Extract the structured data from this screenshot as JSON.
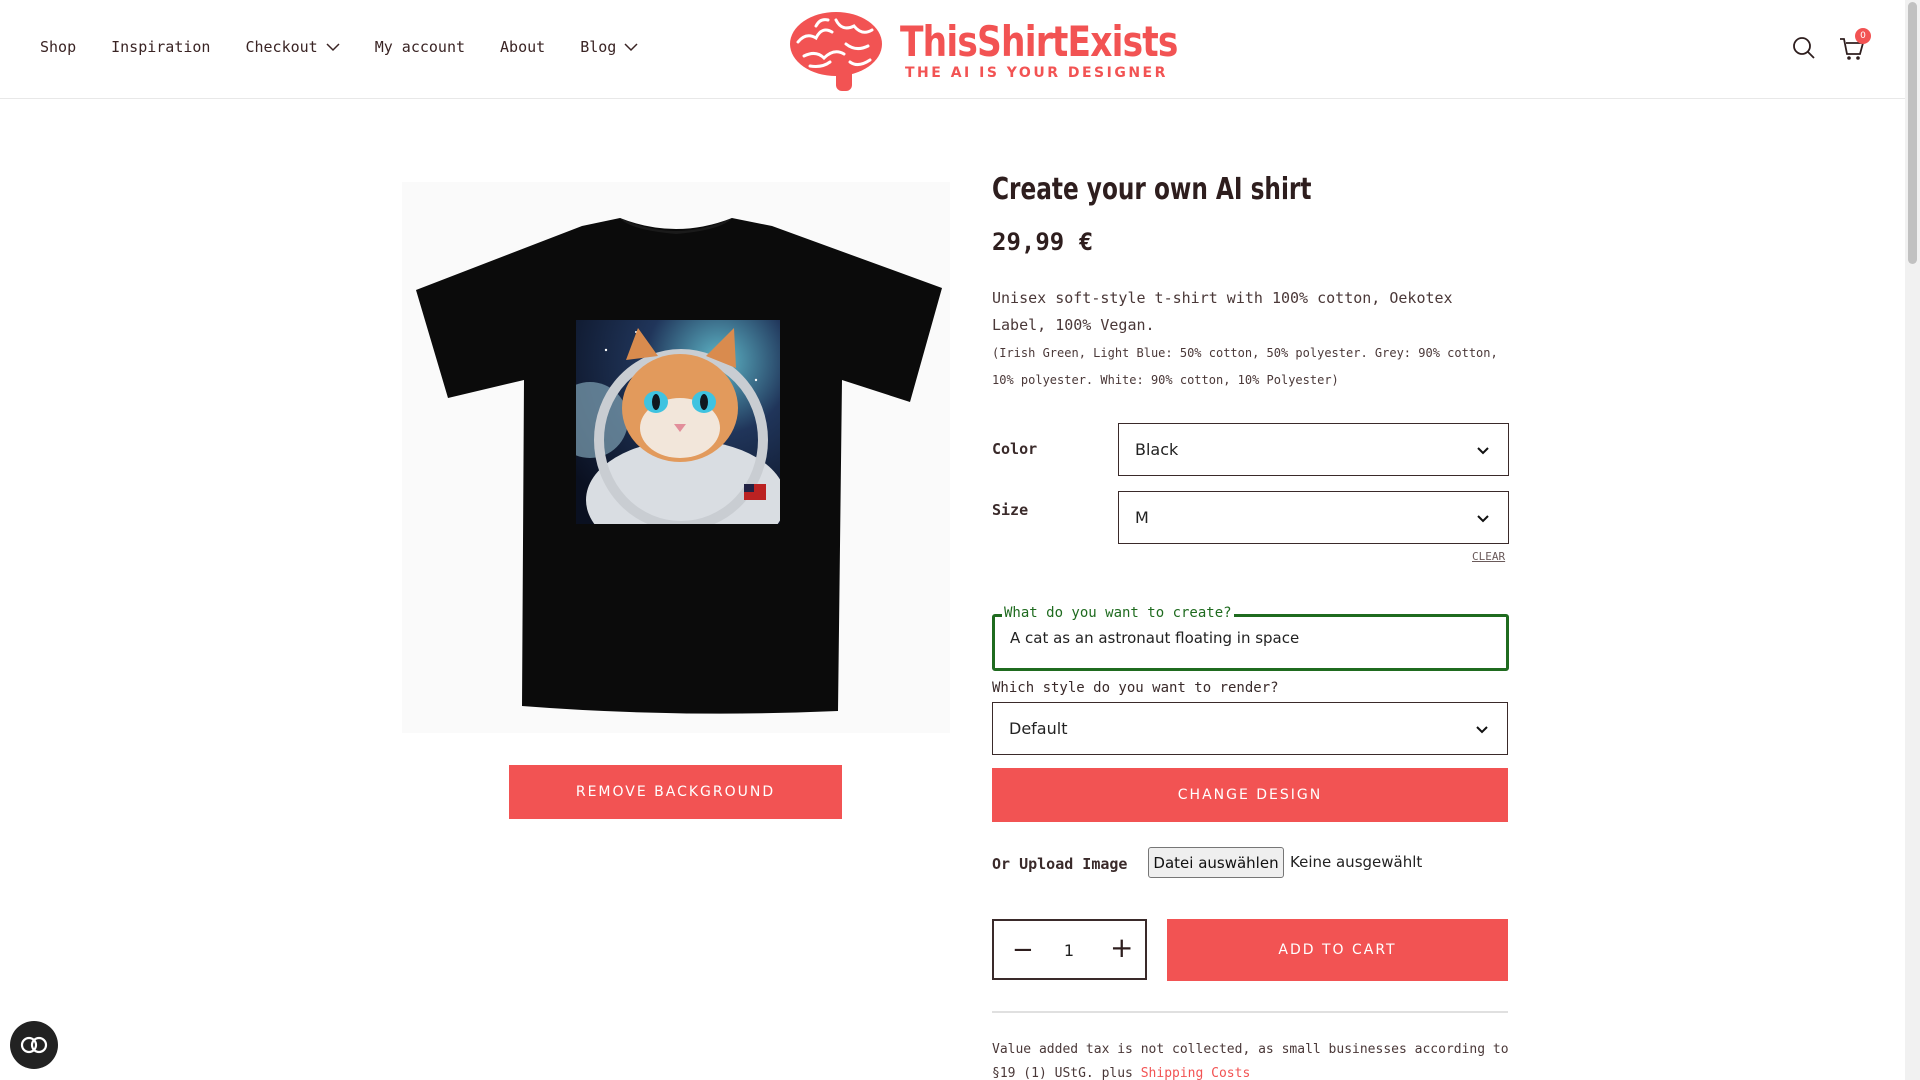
{
  "header": {
    "nav": [
      {
        "label": "Shop",
        "has_dropdown": false
      },
      {
        "label": "Inspiration",
        "has_dropdown": false
      },
      {
        "label": "Checkout",
        "has_dropdown": true
      },
      {
        "label": "My account",
        "has_dropdown": false
      },
      {
        "label": "About",
        "has_dropdown": false
      },
      {
        "label": "Blog",
        "has_dropdown": true
      }
    ],
    "logo_title": "ThisShirtExists",
    "logo_subtitle": "THE AI IS YOUR DESIGNER",
    "cart_count": "0",
    "icons": [
      "search-icon",
      "cart-icon"
    ]
  },
  "product": {
    "remove_bg_label": "REMOVE BACKGROUND",
    "title": "Create your own AI shirt",
    "price": "29,99 €",
    "description": "Unisex soft-style t-shirt with 100% cotton, Oekotex Label, 100% Vegan.",
    "description_small": "(Irish Green, Light Blue: 50% cotton, 50% polyester. Grey: 90% cotton, 10% polyester. White: 90% cotton, 10% Polyester)",
    "color_label": "Color",
    "color_value": "Black",
    "size_label": "Size",
    "size_value": "M",
    "clear_label": "CLEAR",
    "prompt_legend": "What do you want to create?",
    "prompt_value": "A cat as an astronaut floating in space",
    "style_label": "Which style do you want to render?",
    "style_value": "Default",
    "change_design_label": "CHANGE DESIGN",
    "upload_label": "Or Upload Image",
    "file_button": "Datei auswählen",
    "file_status": "Keine ausgewählt",
    "qty_minus": "−",
    "qty_value": "1",
    "qty_plus": "+",
    "add_to_cart_label": "ADD TO CART",
    "tax_text": "Value added tax is not collected, as small businesses according to §19 (1) UStG. plus ",
    "shipping_link": "Shipping Costs"
  },
  "colors": {
    "accent": "#f25353",
    "prompt_border": "#1f6b1f",
    "text": "#3a2a2a"
  }
}
